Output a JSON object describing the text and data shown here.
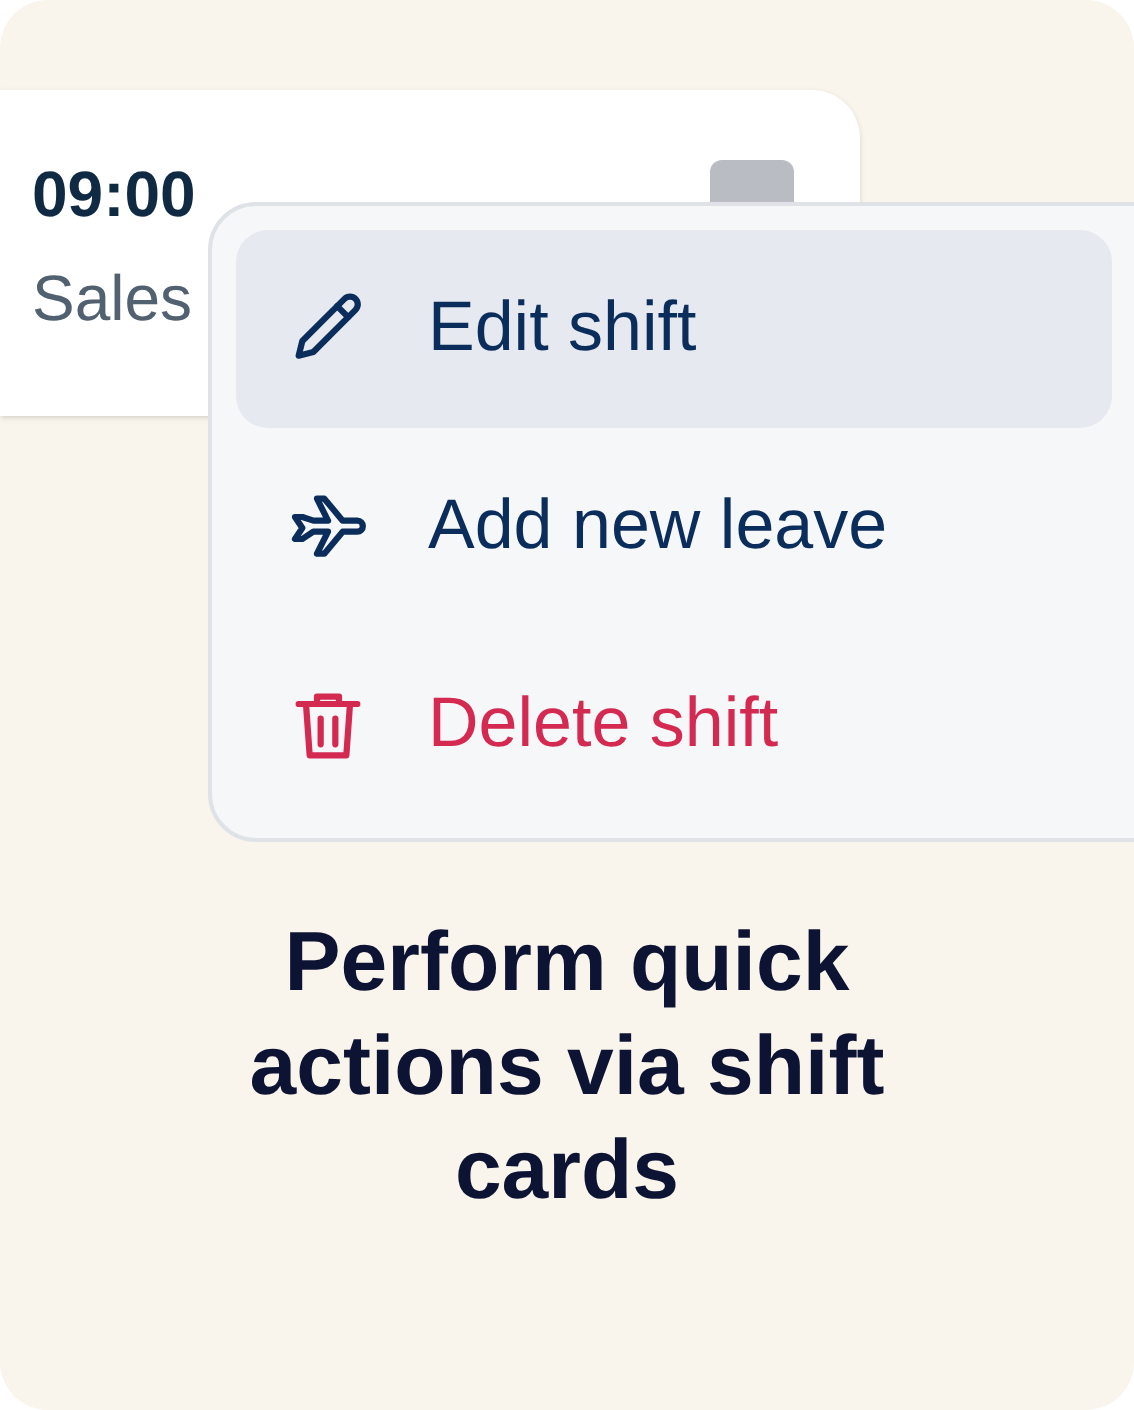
{
  "shift_card": {
    "time": "09:00",
    "department": "Sales"
  },
  "menu": {
    "items": [
      {
        "kind": "edit",
        "label": "Edit shift",
        "selected": true
      },
      {
        "kind": "leave",
        "label": "Add new leave",
        "selected": false
      },
      {
        "kind": "delete",
        "label": "Delete shift",
        "selected": false
      }
    ]
  },
  "caption": "Perform quick actions via shift cards"
}
